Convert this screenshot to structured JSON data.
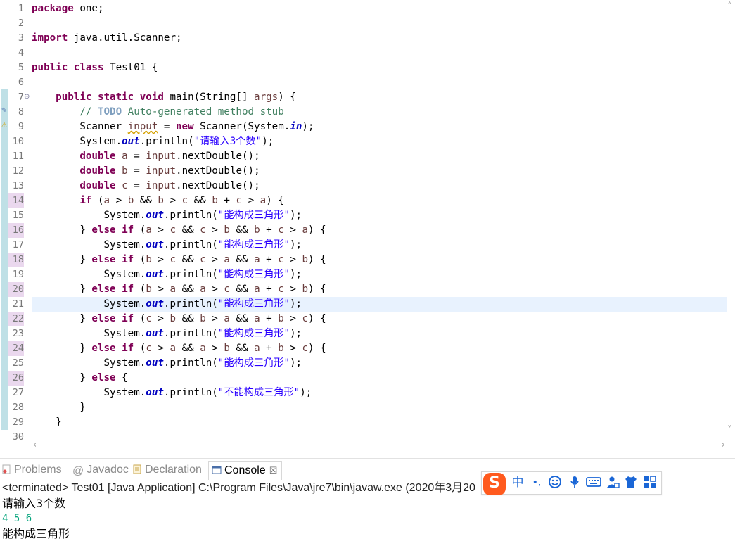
{
  "colors": {
    "keyword": "#7f0055",
    "string": "#2a00ff",
    "comment": "#3f7f5f",
    "field": "#0000c0",
    "current_line": "#e8f2fe",
    "console_input": "#00a37a",
    "ime_brand": "#ff5a1e"
  },
  "editor": {
    "lines": [
      {
        "n": "1",
        "html": "<span class='kw'>package</span> one;"
      },
      {
        "n": "2",
        "html": ""
      },
      {
        "n": "3",
        "html": "<span class='kw'>import</span> java.util.Scanner;"
      },
      {
        "n": "4",
        "html": ""
      },
      {
        "n": "5",
        "html": "<span class='kw'>public class</span> Test01 {"
      },
      {
        "n": "6",
        "html": ""
      },
      {
        "n": "7",
        "html": "    <span class='kw'>public static void</span> main(String[] <span class='var'>args</span>) {",
        "fold": true
      },
      {
        "n": "8",
        "html": "        <span class='cmt'>// </span><span class='todo'>TODO</span><span class='cmt'> Auto-generated method stub</span>"
      },
      {
        "n": "9",
        "html": "        Scanner <span class='var warn'>input</span> = <span class='kw'>new</span> Scanner(System.<span class='fld'>in</span>);"
      },
      {
        "n": "10",
        "html": "        System.<span class='fld'>out</span>.println(<span class='str'>\"请输入3个数\"</span>);"
      },
      {
        "n": "11",
        "html": "        <span class='kw'>double</span> <span class='var'>a</span> = <span class='var'>input</span>.nextDouble();"
      },
      {
        "n": "12",
        "html": "        <span class='kw'>double</span> <span class='var'>b</span> = <span class='var'>input</span>.nextDouble();"
      },
      {
        "n": "13",
        "html": "        <span class='kw'>double</span> <span class='var'>c</span> = <span class='var'>input</span>.nextDouble();"
      },
      {
        "n": "14",
        "html": "        <span class='kw'>if</span> (<span class='var'>a</span> &gt; <span class='var'>b</span> &amp;&amp; <span class='var'>b</span> &gt; <span class='var'>c</span> &amp;&amp; <span class='var'>b</span> + <span class='var'>c</span> &gt; <span class='var'>a</span>) {",
        "changed": true
      },
      {
        "n": "15",
        "html": "            System.<span class='fld'>out</span>.println(<span class='str'>\"能构成三角形\"</span>);"
      },
      {
        "n": "16",
        "html": "        } <span class='kw'>else if</span> (<span class='var'>a</span> &gt; <span class='var'>c</span> &amp;&amp; <span class='var'>c</span> &gt; <span class='var'>b</span> &amp;&amp; <span class='var'>b</span> + <span class='var'>c</span> &gt; <span class='var'>a</span>) {",
        "changed": true
      },
      {
        "n": "17",
        "html": "            System.<span class='fld'>out</span>.println(<span class='str'>\"能构成三角形\"</span>);"
      },
      {
        "n": "18",
        "html": "        } <span class='kw'>else if</span> (<span class='var'>b</span> &gt; <span class='var'>c</span> &amp;&amp; <span class='var'>c</span> &gt; <span class='var'>a</span> &amp;&amp; <span class='var'>a</span> + <span class='var'>c</span> &gt; <span class='var'>b</span>) {",
        "changed": true
      },
      {
        "n": "19",
        "html": "            System.<span class='fld'>out</span>.println(<span class='str'>\"能构成三角形\"</span>);"
      },
      {
        "n": "20",
        "html": "        } <span class='kw'>else if</span> (<span class='var'>b</span> &gt; <span class='var'>a</span> &amp;&amp; <span class='var'>a</span> &gt; <span class='var'>c</span> &amp;&amp; <span class='var'>a</span> + <span class='var'>c</span> &gt; <span class='var'>b</span>) {",
        "changed": true
      },
      {
        "n": "21",
        "html": "            System.<span class='fld'>out</span>.println(<span class='str'>\"能构成三角形\"</span>);",
        "current": true
      },
      {
        "n": "22",
        "html": "        } <span class='kw'>else if</span> (<span class='var'>c</span> &gt; <span class='var'>b</span> &amp;&amp; <span class='var'>b</span> &gt; <span class='var'>a</span> &amp;&amp; <span class='var'>a</span> + <span class='var'>b</span> &gt; <span class='var'>c</span>) {",
        "changed": true
      },
      {
        "n": "23",
        "html": "            System.<span class='fld'>out</span>.println(<span class='str'>\"能构成三角形\"</span>);"
      },
      {
        "n": "24",
        "html": "        } <span class='kw'>else if</span> (<span class='var'>c</span> &gt; <span class='var'>a</span> &amp;&amp; <span class='var'>a</span> &gt; <span class='var'>b</span> &amp;&amp; <span class='var'>a</span> + <span class='var'>b</span> &gt; <span class='var'>c</span>) {",
        "changed": true
      },
      {
        "n": "25",
        "html": "            System.<span class='fld'>out</span>.println(<span class='str'>\"能构成三角形\"</span>);"
      },
      {
        "n": "26",
        "html": "        } <span class='kw'>else</span> {",
        "changed": true
      },
      {
        "n": "27",
        "html": "            System.<span class='fld'>out</span>.println(<span class='str'>\"不能构成三角形\"</span>);"
      },
      {
        "n": "28",
        "html": "        }"
      },
      {
        "n": "29",
        "html": "    }"
      },
      {
        "n": "30",
        "html": ""
      }
    ]
  },
  "tabs": {
    "problems": "Problems",
    "javadoc": "Javadoc",
    "declaration": "Declaration",
    "console": "Console",
    "close_glyph": "☒"
  },
  "console": {
    "header": "<terminated> Test01 [Java Application] C:\\Program Files\\Java\\jre7\\bin\\javaw.exe (2020年3月20",
    "lines": [
      "请输入3个数",
      "4 5 6",
      "能构成三角形"
    ]
  },
  "ime": {
    "logo": "S",
    "lang": "中",
    "punct": "•,",
    "icons": [
      "smiley-icon",
      "mic-icon",
      "keyboard-icon",
      "user-icon",
      "skin-icon",
      "grid-icon"
    ]
  }
}
